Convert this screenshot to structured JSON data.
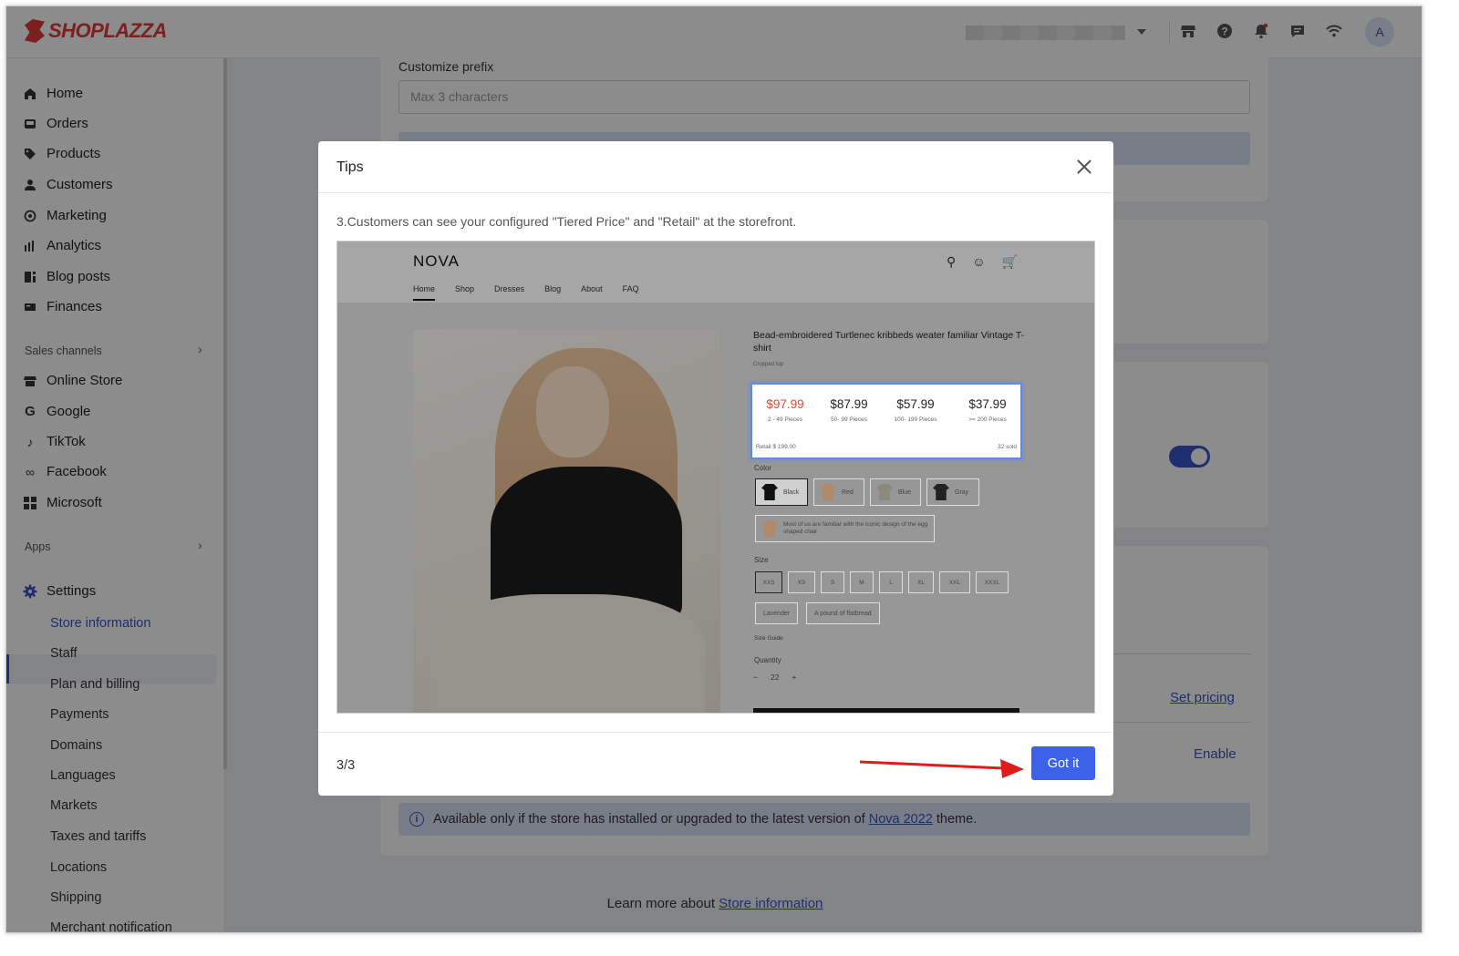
{
  "header": {
    "brand": "SHOPLAZZA",
    "avatar_initial": "A",
    "icons": [
      "store-icon",
      "help-icon",
      "notification-icon",
      "chat-icon",
      "wifi-icon"
    ]
  },
  "sidebar": {
    "main_items": [
      {
        "label": "Home",
        "icon": "home-icon"
      },
      {
        "label": "Orders",
        "icon": "orders-icon"
      },
      {
        "label": "Products",
        "icon": "tag-icon"
      },
      {
        "label": "Customers",
        "icon": "person-icon"
      },
      {
        "label": "Marketing",
        "icon": "marketing-icon"
      },
      {
        "label": "Analytics",
        "icon": "bar-chart-icon"
      },
      {
        "label": "Blog posts",
        "icon": "blog-icon"
      },
      {
        "label": "Finances",
        "icon": "finances-icon"
      }
    ],
    "sales_channels_label": "Sales channels",
    "channels": [
      {
        "label": "Online Store",
        "icon": "store-icon"
      },
      {
        "label": "Google",
        "icon": "google-icon"
      },
      {
        "label": "TikTok",
        "icon": "tiktok-icon"
      },
      {
        "label": "Facebook",
        "icon": "meta-icon"
      },
      {
        "label": "Microsoft",
        "icon": "microsoft-icon"
      }
    ],
    "apps_label": "Apps",
    "settings_label": "Settings",
    "settings_items": [
      "Store information",
      "Staff",
      "Plan and billing",
      "Payments",
      "Domains",
      "Languages",
      "Markets",
      "Taxes and tariffs",
      "Locations",
      "Shipping",
      "Merchant notification"
    ]
  },
  "main": {
    "prefix_label": "Customize prefix",
    "prefix_placeholder": "Max 3 characters",
    "set_pricing": "Set pricing",
    "enable": "Enable",
    "info_prefix": "Available only if the store has installed or upgraded to the latest version of ",
    "info_link": "Nova 2022",
    "info_suffix": " theme.",
    "learn_prefix": "Learn more about ",
    "learn_link": "Store information",
    "toggle_on": true
  },
  "modal": {
    "title": "Tips",
    "description": "3.Customers can see your configured \"Tiered Price\" and \"Retail\" at the storefront.",
    "step": "3/3",
    "button": "Got it",
    "preview": {
      "logo": "NOVA",
      "nav": [
        "Home",
        "Shop",
        "Dresses",
        "Blog",
        "About",
        "FAQ"
      ],
      "product_title": "Bead-embroidered Turtlenec kribbeds weater familiar Vintage T-shirt",
      "product_sub": "Cropped top",
      "tiers": [
        {
          "price": "$97.99",
          "qty": "2 - 49 Pieces"
        },
        {
          "price": "$87.99",
          "qty": "50- 99 Pieces"
        },
        {
          "price": "$57.99",
          "qty": "100- 199 Pieces"
        },
        {
          "price": "$37.99",
          "qty": ">= 200 Pieces"
        }
      ],
      "retail": "Retail $ 199.00",
      "sold": "32 sold",
      "color_label": "Color",
      "colors": [
        "Black",
        "Red",
        "Blue",
        "Gray"
      ],
      "option_note": "Most of us are familiar with the iconic design of the egg shaped chair",
      "size_label": "Size",
      "sizes": [
        "XXS",
        "XS",
        "S",
        "M",
        "L",
        "XL",
        "XXL",
        "XXXL"
      ],
      "extras": [
        "Lavender",
        "A pound of flatbread"
      ],
      "size_guide": "Size Guide",
      "quantity_label": "Quantity",
      "quantity": "22"
    }
  }
}
